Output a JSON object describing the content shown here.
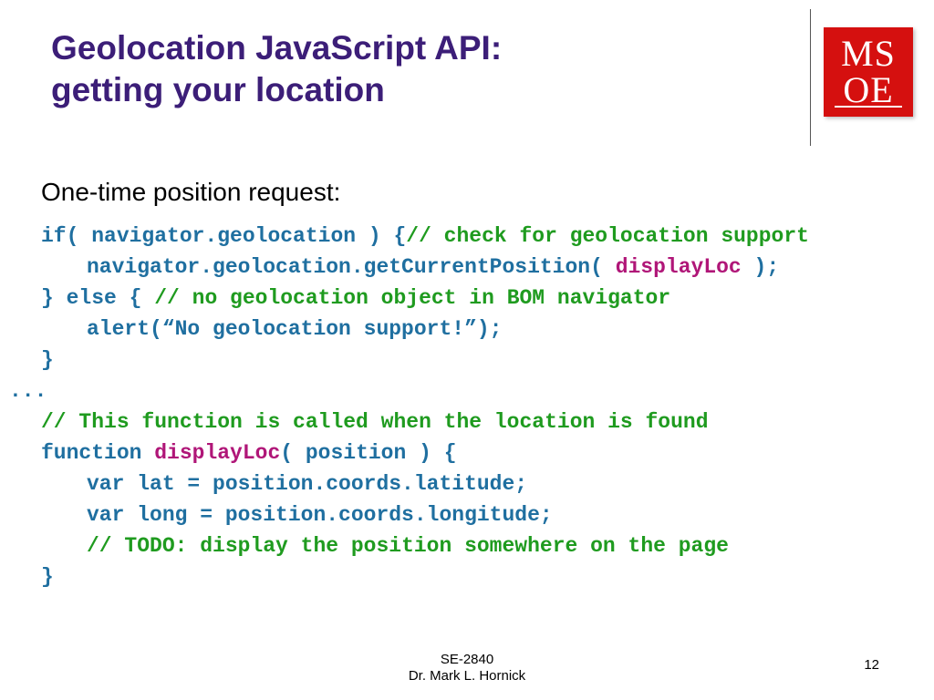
{
  "heading": {
    "line1": "Geolocation JavaScript API:",
    "line2": "getting your location"
  },
  "logo": {
    "top": "MS",
    "bottom": "OE"
  },
  "subtitle": "One-time position request:",
  "code": {
    "l1a": "if( navigator.geolocation ) {",
    "l1b": "// check for geolocation support",
    "l2a": "navigator.geolocation.getCurrentPosition( ",
    "l2b": "displayLoc ",
    "l2c": ");",
    "l3a": "} else { ",
    "l3b": "// no geolocation object in BOM navigator",
    "l4": "alert(“No geolocation support!”);",
    "l5": "}",
    "l6": "...",
    "l7": "// This function is called when the location is found",
    "l8a": "function ",
    "l8b": "displayLoc",
    "l8c": "( position ) {",
    "l9": "var lat = position.coords.latitude;",
    "l10": "var long = position.coords.longitude;",
    "l11a": "// ",
    "l11b": "TODO: display the position somewhere on the page",
    "l12": "}"
  },
  "footer": {
    "course": "SE-2840",
    "author": "Dr. Mark L. Hornick",
    "page": "12"
  }
}
